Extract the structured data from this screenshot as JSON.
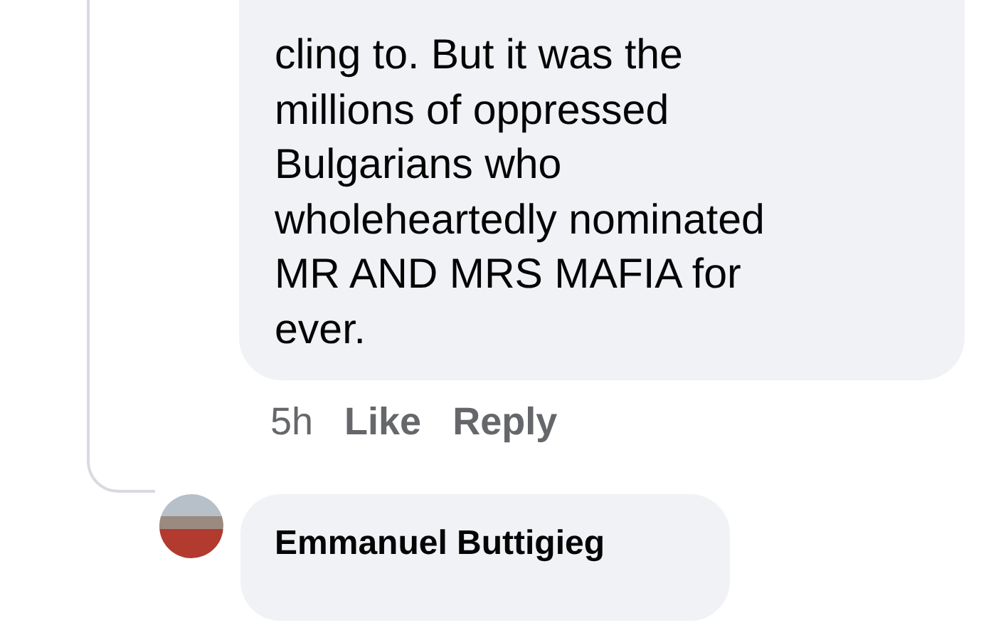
{
  "comment": {
    "text": "cling to. But it was the\nmillions of oppressed\nBulgarians who\nwholeheartedly nominated\nMR AND MRS MAFIA for\never.",
    "time": "5h",
    "actions": [
      "Like",
      "Reply"
    ]
  },
  "reply": {
    "author": "Emmanuel Buttigieg"
  }
}
